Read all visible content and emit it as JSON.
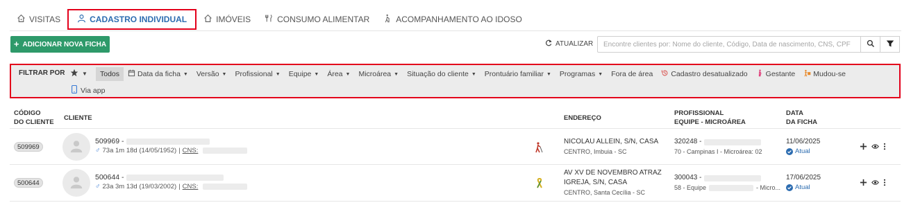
{
  "tabs": [
    {
      "label": "VISITAS",
      "icon": "house-icon"
    },
    {
      "label": "CADASTRO INDIVIDUAL",
      "icon": "person-icon",
      "active": true
    },
    {
      "label": "IMÓVEIS",
      "icon": "home-icon"
    },
    {
      "label": "CONSUMO ALIMENTAR",
      "icon": "cutlery-icon"
    },
    {
      "label": "ACOMPANHAMENTO AO IDOSO",
      "icon": "elderly-icon"
    }
  ],
  "toolbar": {
    "add_label": "ADICIONAR NOVA FICHA",
    "refresh_label": "ATUALIZAR",
    "search_placeholder": "Encontre clientes por: Nome do cliente, Código, Data de nascimento, CNS, CPF"
  },
  "filters": {
    "label": "FILTRAR POR",
    "chips": [
      {
        "label": "Todos",
        "active": true
      },
      {
        "label": "Data da ficha",
        "icon": "calendar-icon",
        "dropdown": true
      },
      {
        "label": "Versão",
        "dropdown": true
      },
      {
        "label": "Profissional",
        "dropdown": true
      },
      {
        "label": "Equipe",
        "dropdown": true
      },
      {
        "label": "Área",
        "dropdown": true
      },
      {
        "label": "Microárea",
        "dropdown": true
      },
      {
        "label": "Situação do cliente",
        "dropdown": true
      },
      {
        "label": "Prontuário familiar",
        "dropdown": true
      },
      {
        "label": "Programas",
        "dropdown": true
      },
      {
        "label": "Fora de área"
      },
      {
        "label": "Cadastro desatualizado",
        "icon": "history-icon"
      },
      {
        "label": "Gestante",
        "icon": "pregnant-icon"
      },
      {
        "label": "Mudou-se",
        "icon": "moving-icon"
      }
    ],
    "via_app": "Via app"
  },
  "table": {
    "headers": {
      "codigo": [
        "CÓDIGO",
        "DO CLIENTE"
      ],
      "cliente": "CLIENTE",
      "endereco": "ENDEREÇO",
      "profissional": [
        "PROFISSIONAL",
        "EQUIPE - MICROÁREA"
      ],
      "data": [
        "DATA",
        "DA FICHA"
      ]
    },
    "rows": [
      {
        "code": "509969",
        "name_prefix": "509969 -",
        "info": "73a 1m 18d (14/05/1952)",
        "cns_label": "CNS:",
        "condition_icon": "cane-icon",
        "address_lines": [
          "NICOLAU ALLEIN, S/N, CASA"
        ],
        "address_sub": "CENTRO, Imbuia - SC",
        "prof_prefix": "320248 -",
        "prof_sub": "70 - Campinas I - Microárea: 02",
        "date": "11/06/2025",
        "status": "Atual"
      },
      {
        "code": "500644",
        "name_prefix": "500644 -",
        "info": "23a 3m 13d (19/03/2002)",
        "cns_label": "CNS:",
        "condition_icon": "ribbon-icon",
        "address_lines": [
          "AV XV DE NOVEMBRO ATRAZ",
          "IGREJA, S/N, CASA"
        ],
        "address_sub": "CENTRO, Santa Cecília - SC",
        "prof_prefix": "300043 -",
        "prof_sub": "58 - Equipe",
        "prof_sub_tail": "- Micro...",
        "date": "17/06/2025",
        "status": "Atual"
      }
    ]
  },
  "colors": {
    "accent": "#2c6cb0",
    "add_button": "#2e9a6a",
    "highlight_border": "#e3001b",
    "filter_bg": "#ececec"
  }
}
